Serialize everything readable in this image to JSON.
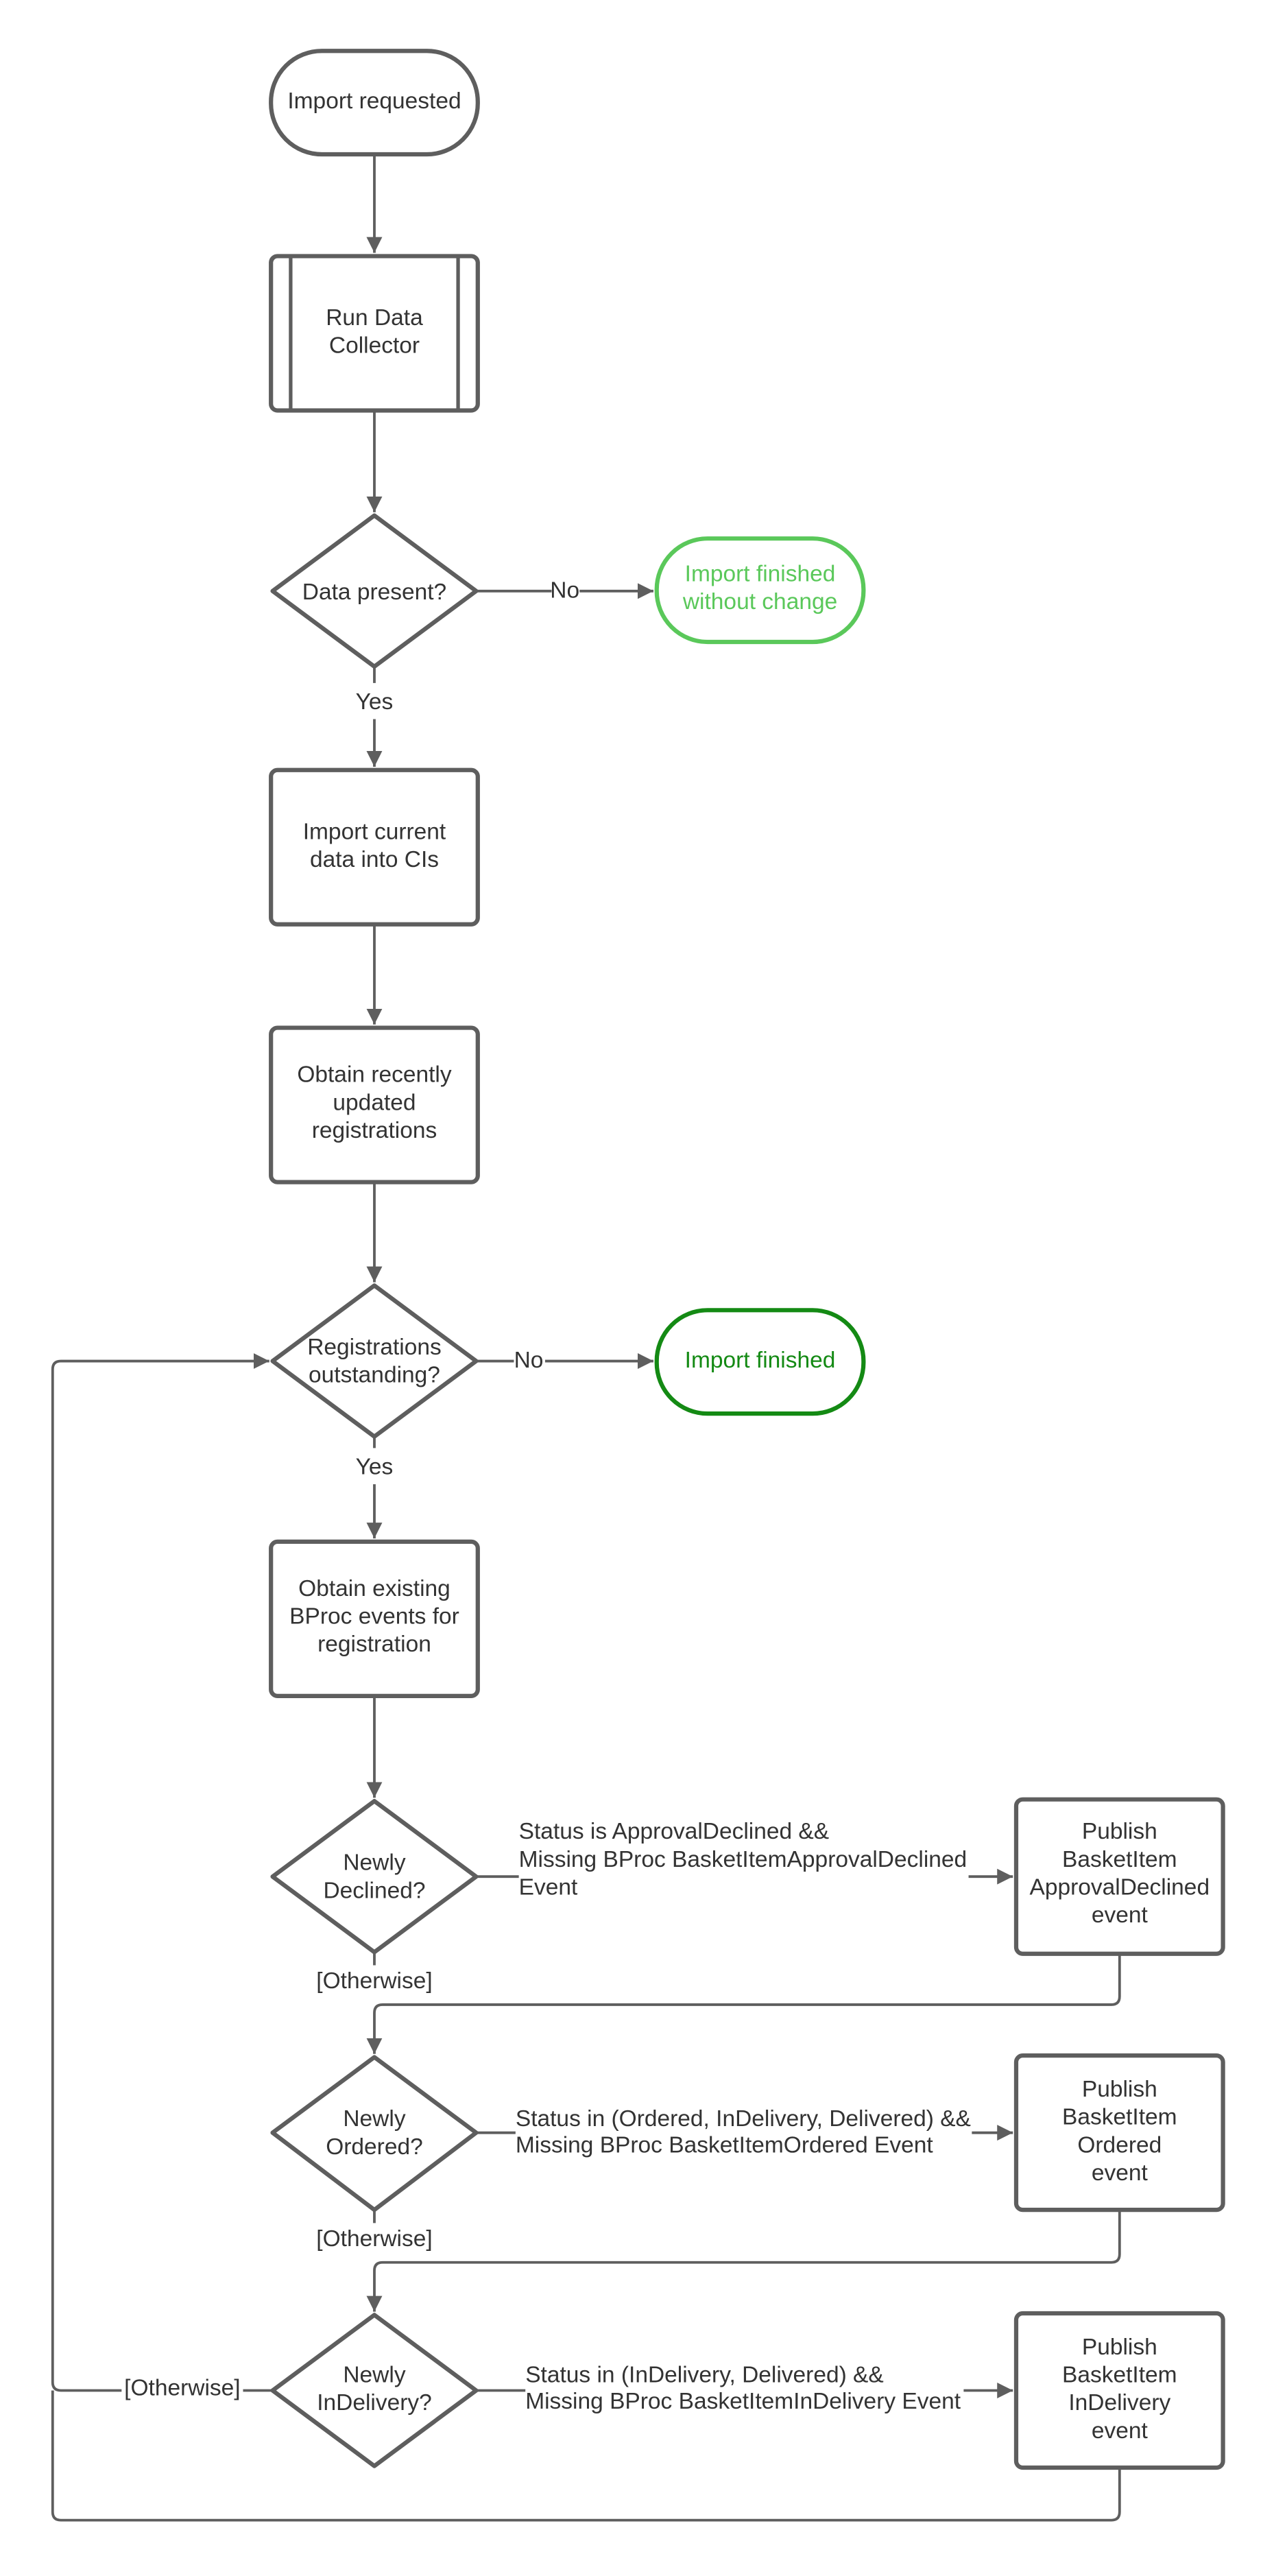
{
  "colors": {
    "stroke": "#5e5e5e",
    "text": "#333333",
    "end_no_change": "#5ac85a",
    "end_finished": "#148a14"
  },
  "nodes": {
    "start": [
      "Import requested"
    ],
    "collector": [
      "Run Data",
      "Collector"
    ],
    "data_present": [
      "Data present?"
    ],
    "end_no_change": [
      "Import finished",
      "without change"
    ],
    "import_current": [
      "Import current",
      "data into CIs"
    ],
    "obtain_recent": [
      "Obtain recently",
      "updated",
      "registrations"
    ],
    "registrations_outstanding": [
      "Registrations",
      "outstanding?"
    ],
    "end_finished": [
      "Import finished"
    ],
    "obtain_existing": [
      "Obtain existing",
      "BProc events for",
      "registration"
    ],
    "newly_declined": [
      "Newly",
      "Declined?"
    ],
    "publish_declined": [
      "Publish",
      "BasketItem",
      "ApprovalDeclined",
      "event"
    ],
    "newly_ordered": [
      "Newly",
      "Ordered?"
    ],
    "publish_ordered": [
      "Publish",
      "BasketItem",
      "Ordered",
      "event"
    ],
    "newly_indelivery": [
      "Newly",
      "InDelivery?"
    ],
    "publish_indelivery": [
      "Publish",
      "BasketItem",
      "InDelivery",
      "event"
    ]
  },
  "edges": {
    "no1": "No",
    "yes1": "Yes",
    "no2": "No",
    "yes2": "Yes",
    "declined_cond": [
      "Status is ApprovalDeclined &&",
      "Missing BProc BasketItemApprovalDeclined",
      "Event"
    ],
    "otherwise1": "[Otherwise]",
    "ordered_cond": [
      "Status in (Ordered, InDelivery, Delivered) &&",
      "Missing BProc BasketItemOrdered Event"
    ],
    "otherwise2": "[Otherwise]",
    "indelivery_cond": [
      "Status in (InDelivery, Delivered) &&",
      "Missing BProc BasketItemInDelivery Event"
    ],
    "otherwise3": "[Otherwise]"
  }
}
